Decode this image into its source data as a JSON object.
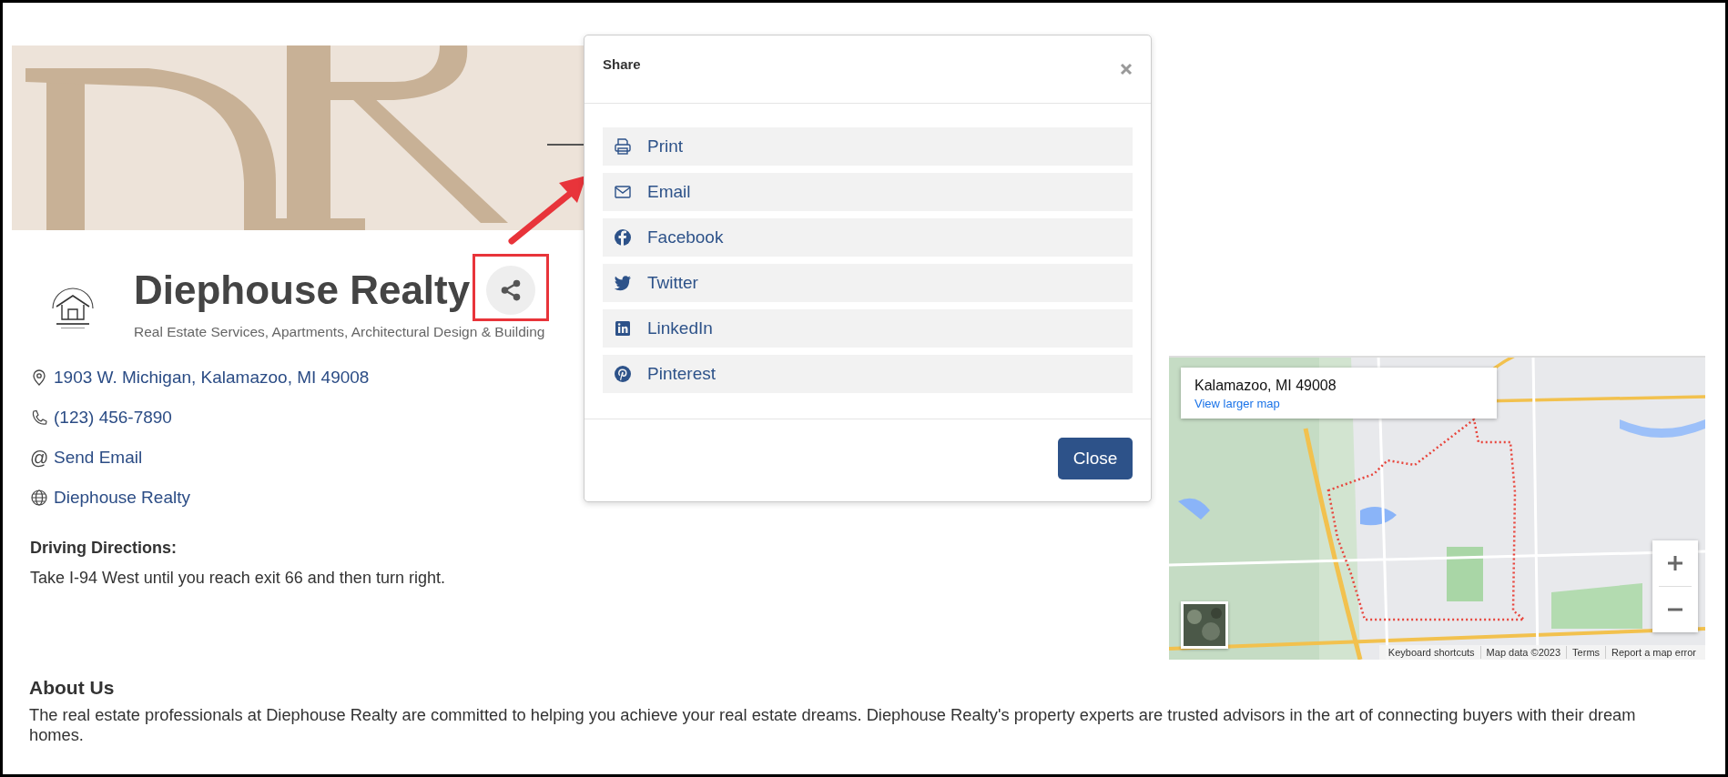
{
  "business": {
    "name": "Diephouse Realty",
    "categories": "Real Estate Services, Apartments, Architectural Design & Building"
  },
  "contacts": [
    {
      "kind": "address",
      "text": "1903 W. Michigan, Kalamazoo, MI 49008"
    },
    {
      "kind": "phone",
      "text": "(123) 456-7890"
    },
    {
      "kind": "email",
      "icon": "@",
      "text": "Send Email"
    },
    {
      "kind": "website",
      "text": "Diephouse Realty"
    }
  ],
  "directions": {
    "heading": "Driving Directions:",
    "text": "Take I-94 West until you reach exit 66 and then turn right."
  },
  "map": {
    "kind": "picture",
    "place": "Kalamazoo, MI 49008",
    "link": "View larger map",
    "footer": [
      "Keyboard shortcuts",
      "Map data ©2023",
      "Terms",
      "Report a map error"
    ]
  },
  "about": {
    "heading": "About Us",
    "text": "The real estate professionals at Diephouse Realty are committed to helping you achieve your real estate dreams. Diephouse Realty's property experts are trusted advisors in the art of connecting buyers with their dream homes."
  },
  "share_modal": {
    "title": "Share",
    "items": [
      {
        "kind": "print",
        "label": "Print"
      },
      {
        "kind": "email",
        "label": "Email"
      },
      {
        "kind": "facebook",
        "label": "Facebook"
      },
      {
        "kind": "twitter",
        "label": "Twitter"
      },
      {
        "kind": "linkedin",
        "label": "LinkedIn"
      },
      {
        "kind": "pinterest",
        "label": "Pinterest"
      }
    ],
    "button": "Close"
  }
}
